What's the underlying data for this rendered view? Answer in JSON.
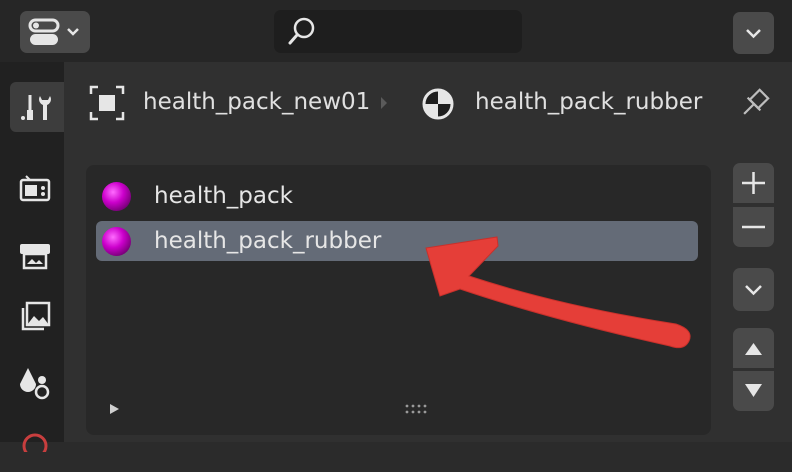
{
  "breadcrumb": {
    "object_name": "health_pack_new01",
    "material_name": "health_pack_rubber"
  },
  "material_slots": [
    {
      "name": "health_pack",
      "selected": false
    },
    {
      "name": "health_pack_rubber",
      "selected": true
    }
  ],
  "colors": {
    "selection": "#646b77",
    "material_ball": "#cc00cc",
    "annotation_arrow": "#e53e38"
  },
  "icons": {
    "editor_type": "properties-editor-icon",
    "search": "search-icon",
    "pin": "pin-icon",
    "annotation": "red-arrow"
  }
}
